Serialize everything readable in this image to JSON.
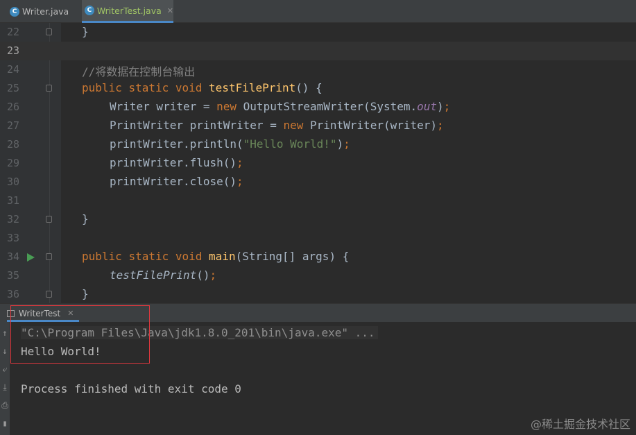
{
  "tabs": [
    {
      "label": "Writer.java",
      "icon": "java-class-icon"
    },
    {
      "label": "WriterTest.java",
      "icon": "java-class-icon",
      "active": true
    }
  ],
  "editor": {
    "current_line": "23",
    "lines": [
      {
        "num": "22",
        "text": "}"
      },
      {
        "num": "23",
        "text": ""
      },
      {
        "num": "24",
        "text": "//将数据在控制台输出"
      },
      {
        "num": "25",
        "text": "public static void testFilePrint() {"
      },
      {
        "num": "26",
        "text": "Writer writer = new OutputStreamWriter(System.out);"
      },
      {
        "num": "27",
        "text": "PrintWriter printWriter = new PrintWriter(writer);"
      },
      {
        "num": "28",
        "text": "printWriter.println(\"Hello World!\");"
      },
      {
        "num": "29",
        "text": "printWriter.flush();"
      },
      {
        "num": "30",
        "text": "printWriter.close();"
      },
      {
        "num": "31",
        "text": ""
      },
      {
        "num": "32",
        "text": "}"
      },
      {
        "num": "33",
        "text": ""
      },
      {
        "num": "34",
        "text": "public static void main(String[] args) {"
      },
      {
        "num": "35",
        "text": "testFilePrint();"
      },
      {
        "num": "36",
        "text": "}"
      }
    ]
  },
  "console": {
    "tab_label": "WriterTest",
    "command": "\"C:\\Program Files\\Java\\jdk1.8.0_201\\bin\\java.exe\" ...",
    "output": "Hello World!",
    "exit_message": "Process finished with exit code 0"
  },
  "watermark": "@稀土掘金技术社区",
  "colors": {
    "editor_bg": "#2b2b2b",
    "keyword": "#cc7832",
    "function": "#ffc66d",
    "string": "#6a8759",
    "comment": "#808080",
    "highlight_box": "#e0383e"
  }
}
